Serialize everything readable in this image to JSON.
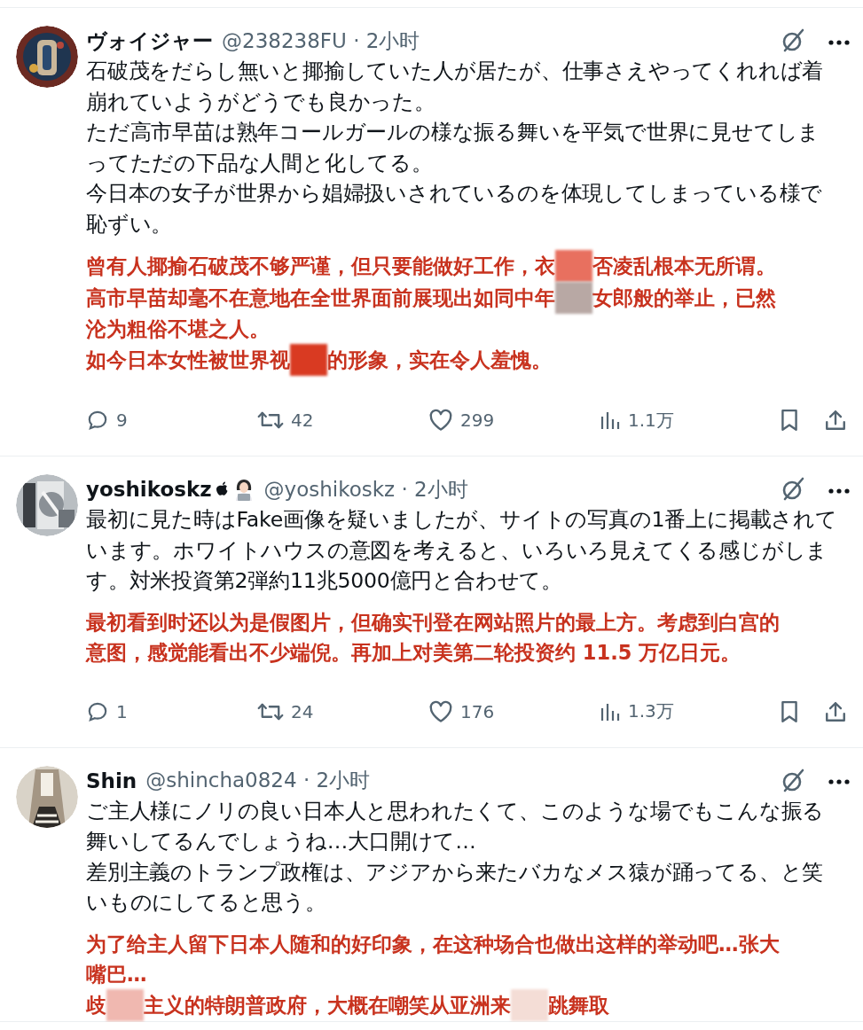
{
  "tweets": [
    {
      "name": "ヴォイジャー",
      "meta": "@238238FU · 2小时",
      "body": [
        "石破茂をだらし無いと揶揄していた人が居たが、仕事さえやってくれれば着",
        "崩れていようがどうでも良かった。",
        "ただ高市早苗は熟年コールガールの様な振る舞いを平気で世界に見せてしま",
        "ってただの下品な人間と化してる。",
        "今日本の女子が世界から娼婦扱いされているのを体現してしまっている様で",
        "恥ずい。"
      ],
      "translation": [
        [
          {
            "kind": "text",
            "text": "曾有人揶揄石破茂不够严谨，但只要能做好工作，衣"
          },
          {
            "kind": "censor",
            "color": "#e8705f"
          },
          {
            "kind": "text",
            "text": "否凌乱根本无所谓。"
          }
        ],
        [
          {
            "kind": "text",
            "text": "高市早苗却毫不在意地在全世界面前展现出如同中年"
          },
          {
            "kind": "censor",
            "color": "#b8a8a4"
          },
          {
            "kind": "text",
            "text": "女郎般的举止，已然"
          }
        ],
        [
          {
            "kind": "text",
            "text": "沦为粗俗不堪之人。"
          }
        ],
        [
          {
            "kind": "text",
            "text": "如今日本女性被世界视"
          },
          {
            "kind": "censor",
            "color": "#d93a22"
          },
          {
            "kind": "text",
            "text": "的形象，实在令人羞愧。"
          }
        ]
      ],
      "stats": {
        "replies": "9",
        "reposts": "42",
        "likes": "299",
        "views": "1.1万"
      }
    },
    {
      "name": "yoshikoskz",
      "badges": [
        {
          "kind": "apple"
        },
        {
          "kind": "laptop-woman"
        }
      ],
      "meta": "@yoshikoskz · 2小时",
      "body": [
        "最初に見た時はFake画像を疑いましたが、サイトの写真の1番上に掲載されて",
        "います。ホワイトハウスの意図を考えると、いろいろ見えてくる感じがしま",
        "す。対米投資第2弾約11兆5000億円と合わせて。"
      ],
      "translation": [
        [
          {
            "kind": "text",
            "text": "最初看到时还以为是假图片，但确实刊登在网站照片的最上方。考虑到白宫的"
          }
        ],
        [
          {
            "kind": "text",
            "text": "意图，感觉能看出不少端倪。再加上对美第二轮投资约 11.5 万亿日元。"
          }
        ]
      ],
      "stats": {
        "replies": "1",
        "reposts": "24",
        "likes": "176",
        "views": "1.3万"
      }
    },
    {
      "name": "Shin",
      "meta": "@shincha0824 · 2小时",
      "body": [
        "ご主人様にノリの良い日本人と思われたくて、このような場でもこんな振る",
        "舞いしてるんでしょうね…大口開けて…",
        "差別主義のトランプ政権は、アジアから来たバカなメス猿が踊ってる、と笑",
        "いものにしてると思う。"
      ],
      "translation": [
        [
          {
            "kind": "text",
            "text": "为了给主人留下日本人随和的好印象，在这种场合也做出这样的举动吧…张大"
          }
        ],
        [
          {
            "kind": "text",
            "text": "嘴巴…"
          }
        ],
        [
          {
            "kind": "text",
            "text": "歧"
          },
          {
            "kind": "censor",
            "color": "#f0b8b0"
          },
          {
            "kind": "text",
            "text": "主义的特朗普政府，大概在嘲笑从亚洲来"
          },
          {
            "kind": "censor",
            "color": "#f4ddd6"
          },
          {
            "kind": "text",
            "text": "跳舞取"
          }
        ]
      ]
    }
  ]
}
